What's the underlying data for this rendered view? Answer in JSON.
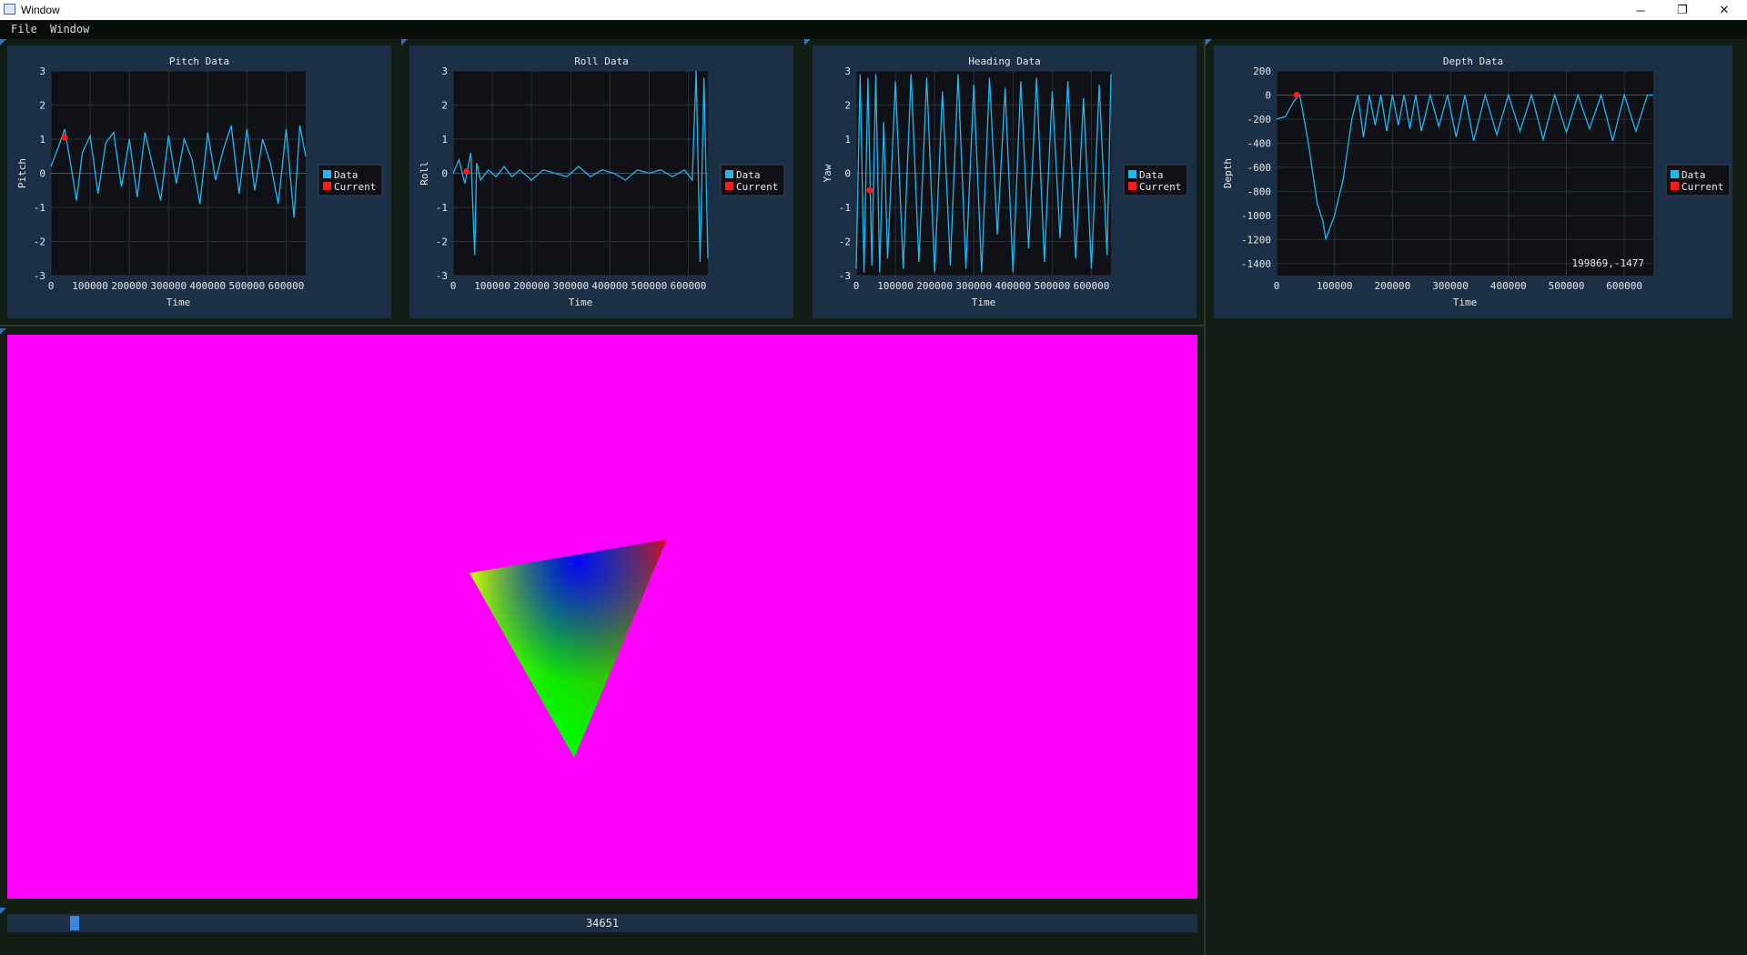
{
  "window": {
    "title": "Window",
    "minimize_glyph": "─",
    "maximize_glyph": "❐",
    "close_glyph": "✕"
  },
  "menu": [
    "File",
    "Window"
  ],
  "legend_labels": [
    "Data",
    "Current"
  ],
  "colors": {
    "data_line": "#1fb8f0",
    "current_marker": "#ff1a1a",
    "panel_bg": "#1b2f47",
    "plot_bg": "#0f1117",
    "viewport_bg": "#ff00ff"
  },
  "charts": [
    {
      "title": "Pitch Data",
      "xlabel": "Time",
      "ylabel": "Pitch",
      "ylim": [
        -3,
        3
      ],
      "yticks": [
        "3",
        "2",
        "1",
        "0",
        "-1",
        "-2",
        "-3"
      ],
      "xlim": [
        0,
        650000
      ],
      "xticks": [
        "0",
        "100000",
        "200000",
        "300000",
        "400000",
        "500000",
        "600000"
      ],
      "current": [
        34651,
        1.05
      ]
    },
    {
      "title": "Roll Data",
      "xlabel": "Time",
      "ylabel": "Roll",
      "ylim": [
        -3,
        3
      ],
      "yticks": [
        "3",
        "2",
        "1",
        "0",
        "-1",
        "-2",
        "-3"
      ],
      "xlim": [
        0,
        650000
      ],
      "xticks": [
        "0",
        "100000",
        "200000",
        "300000",
        "400000",
        "500000",
        "600000"
      ],
      "current": [
        34651,
        0.05
      ]
    },
    {
      "title": "Heading Data",
      "xlabel": "Time",
      "ylabel": "Yaw",
      "ylim": [
        -3,
        3
      ],
      "yticks": [
        "3",
        "2",
        "1",
        "0",
        "-1",
        "-2",
        "-3"
      ],
      "xlim": [
        0,
        650000
      ],
      "xticks": [
        "0",
        "100000",
        "200000",
        "300000",
        "400000",
        "500000",
        "600000"
      ],
      "current": [
        34651,
        -0.5
      ]
    },
    {
      "title": "Depth Data",
      "xlabel": "Time",
      "ylabel": "Depth",
      "ylim": [
        -1500,
        200
      ],
      "yticks": [
        "200",
        "0",
        "-200",
        "-400",
        "-600",
        "-800",
        "-1000",
        "-1200",
        "-1400"
      ],
      "xlim": [
        0,
        650000
      ],
      "xticks": [
        "0",
        "100000",
        "200000",
        "300000",
        "400000",
        "500000",
        "600000"
      ],
      "current": [
        34651,
        0
      ],
      "hover_readout": "199869,-1477"
    }
  ],
  "chart_data": [
    {
      "type": "line",
      "title": "Pitch Data",
      "xlabel": "Time",
      "ylabel": "Pitch",
      "ylim": [
        -3,
        3
      ],
      "xlim": [
        0,
        650000
      ],
      "legend": "right",
      "series": [
        {
          "name": "Data",
          "x": [
            0,
            20000,
            35000,
            50000,
            65000,
            80000,
            100000,
            120000,
            140000,
            160000,
            180000,
            200000,
            220000,
            240000,
            260000,
            280000,
            300000,
            320000,
            340000,
            360000,
            380000,
            400000,
            420000,
            440000,
            460000,
            480000,
            500000,
            520000,
            540000,
            560000,
            580000,
            600000,
            620000,
            635000,
            650000
          ],
          "values": [
            0.2,
            0.8,
            1.3,
            0.3,
            -0.8,
            0.6,
            1.1,
            -0.6,
            0.9,
            1.2,
            -0.4,
            1.0,
            -0.7,
            1.2,
            0.2,
            -0.8,
            1.1,
            -0.3,
            1.0,
            0.4,
            -0.9,
            1.2,
            -0.2,
            0.7,
            1.4,
            -0.6,
            1.3,
            -0.5,
            1.0,
            0.3,
            -0.9,
            1.3,
            -1.3,
            1.4,
            0.5
          ]
        },
        {
          "name": "Current",
          "x": [
            34651
          ],
          "values": [
            1.05
          ]
        }
      ]
    },
    {
      "type": "line",
      "title": "Roll Data",
      "xlabel": "Time",
      "ylabel": "Roll",
      "ylim": [
        -3,
        3
      ],
      "xlim": [
        0,
        650000
      ],
      "legend": "right",
      "series": [
        {
          "name": "Data",
          "x": [
            0,
            15000,
            30000,
            45000,
            55000,
            60000,
            70000,
            90000,
            110000,
            130000,
            150000,
            170000,
            200000,
            230000,
            260000,
            290000,
            320000,
            350000,
            380000,
            410000,
            440000,
            470000,
            500000,
            530000,
            560000,
            590000,
            610000,
            620000,
            630000,
            640000,
            650000
          ],
          "values": [
            0.0,
            0.4,
            -0.3,
            0.6,
            -2.4,
            0.3,
            -0.2,
            0.1,
            -0.1,
            0.2,
            -0.1,
            0.1,
            -0.2,
            0.1,
            0.0,
            -0.1,
            0.2,
            -0.1,
            0.1,
            0.0,
            -0.2,
            0.1,
            0.0,
            0.1,
            -0.1,
            0.1,
            -0.2,
            3.0,
            -2.6,
            2.8,
            -2.5
          ]
        },
        {
          "name": "Current",
          "x": [
            34651
          ],
          "values": [
            0.05
          ]
        }
      ]
    },
    {
      "type": "line",
      "title": "Heading Data",
      "xlabel": "Time",
      "ylabel": "Yaw",
      "ylim": [
        -3,
        3
      ],
      "xlim": [
        0,
        650000
      ],
      "legend": "right",
      "series": [
        {
          "name": "Data",
          "x": [
            0,
            10000,
            20000,
            30000,
            40000,
            50000,
            60000,
            70000,
            80000,
            100000,
            120000,
            140000,
            160000,
            180000,
            200000,
            220000,
            240000,
            260000,
            280000,
            300000,
            320000,
            340000,
            360000,
            380000,
            400000,
            420000,
            440000,
            460000,
            480000,
            500000,
            520000,
            540000,
            560000,
            580000,
            600000,
            620000,
            640000,
            650000
          ],
          "values": [
            -2.8,
            2.9,
            -2.9,
            2.8,
            -2.7,
            2.9,
            -2.9,
            1.5,
            -2.5,
            2.7,
            -2.8,
            2.9,
            -2.6,
            2.8,
            -2.9,
            2.4,
            -2.7,
            2.9,
            -2.8,
            2.6,
            -2.9,
            2.8,
            -1.8,
            2.5,
            -2.9,
            2.7,
            -2.2,
            2.8,
            -2.6,
            2.4,
            -1.9,
            2.7,
            -2.5,
            2.2,
            -2.8,
            2.6,
            -2.4,
            2.9
          ]
        },
        {
          "name": "Current",
          "x": [
            34651
          ],
          "values": [
            -0.5
          ]
        }
      ]
    },
    {
      "type": "line",
      "title": "Depth Data",
      "xlabel": "Time",
      "ylabel": "Depth",
      "ylim": [
        -1500,
        200
      ],
      "xlim": [
        0,
        650000
      ],
      "legend": "right",
      "series": [
        {
          "name": "Data",
          "x": [
            0,
            15000,
            30000,
            40000,
            55000,
            70000,
            80000,
            85000,
            100000,
            115000,
            130000,
            140000,
            150000,
            160000,
            170000,
            180000,
            190000,
            200000,
            210000,
            220000,
            230000,
            240000,
            250000,
            265000,
            280000,
            295000,
            310000,
            325000,
            340000,
            360000,
            380000,
            400000,
            420000,
            440000,
            460000,
            480000,
            500000,
            520000,
            540000,
            560000,
            580000,
            600000,
            620000,
            640000,
            650000
          ],
          "values": [
            -200,
            -180,
            -50,
            0,
            -400,
            -900,
            -1050,
            -1200,
            -1000,
            -700,
            -200,
            0,
            -350,
            0,
            -250,
            0,
            -300,
            0,
            -250,
            0,
            -280,
            0,
            -300,
            0,
            -260,
            0,
            -350,
            0,
            -380,
            0,
            -330,
            0,
            -300,
            0,
            -370,
            0,
            -310,
            0,
            -280,
            0,
            -380,
            0,
            -300,
            0,
            0
          ]
        },
        {
          "name": "Current",
          "x": [
            34651
          ],
          "values": [
            0
          ]
        }
      ]
    }
  ],
  "slider": {
    "value": "34651",
    "fraction": 0.053
  }
}
